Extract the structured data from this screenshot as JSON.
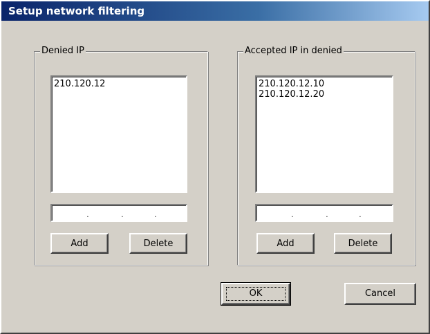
{
  "dialog": {
    "title": "Setup network filtering"
  },
  "denied_group": {
    "legend": "Denied IP",
    "items": [
      "210.120.12"
    ],
    "ip_input": [
      "",
      "",
      "",
      ""
    ],
    "add_label": "Add",
    "delete_label": "Delete"
  },
  "accepted_group": {
    "legend": "Accepted IP in denied",
    "items": [
      "210.120.12.10",
      "210.120.12.20"
    ],
    "ip_input": [
      "",
      "",
      "",
      ""
    ],
    "add_label": "Add",
    "delete_label": "Delete"
  },
  "footer": {
    "ok_label": "OK",
    "cancel_label": "Cancel"
  },
  "colors": {
    "face": "#d4d0c8",
    "title_start": "#0a246a",
    "title_end": "#a6caf0"
  }
}
